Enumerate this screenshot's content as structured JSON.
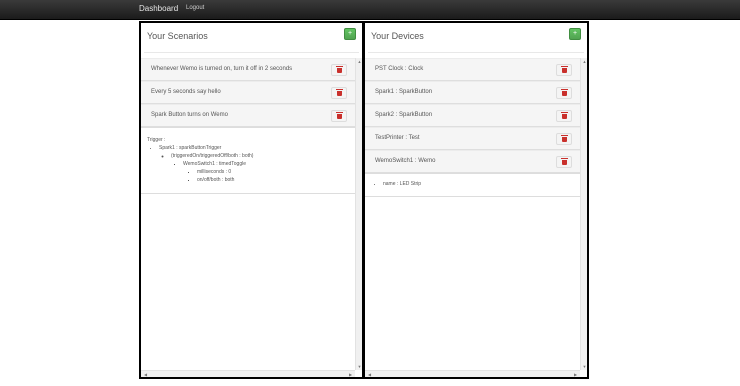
{
  "navbar": {
    "brand": "Dashboard",
    "logout": "Logout"
  },
  "scenarios": {
    "title": "Your Scenarios",
    "add_label": "+",
    "items": [
      {
        "label": "Whenever Wemo is turned on, turn it off in 2 seconds"
      },
      {
        "label": "Every 5 seconds say hello"
      },
      {
        "label": "Spark Button turns on Wemo"
      }
    ],
    "detail": {
      "title": "Trigger :",
      "l1": "Spark1 : sparkButtonTrigger",
      "l2": "(triggeredOn/triggeredOff/both : both)",
      "l3": "WemoSwitch1 : timedToggle",
      "l4a": "milliseconds : 0",
      "l4b": "on/off/both : both"
    }
  },
  "devices": {
    "title": "Your Devices",
    "add_label": "+",
    "items": [
      {
        "label": "PST Clock : Clock"
      },
      {
        "label": "Spark1 : SparkButton"
      },
      {
        "label": "Spark2 : SparkButton"
      },
      {
        "label": "TestPrinter : Test"
      },
      {
        "label": "WemoSwitch1 : Wemo"
      }
    ],
    "detail": {
      "l1": "name : LED Strip"
    }
  },
  "colors": {
    "add_green": "#51a351",
    "trash_red": "#c9302c",
    "navbar": "#222222"
  },
  "icons": {
    "add": "plus-icon",
    "delete": "trash-icon"
  }
}
